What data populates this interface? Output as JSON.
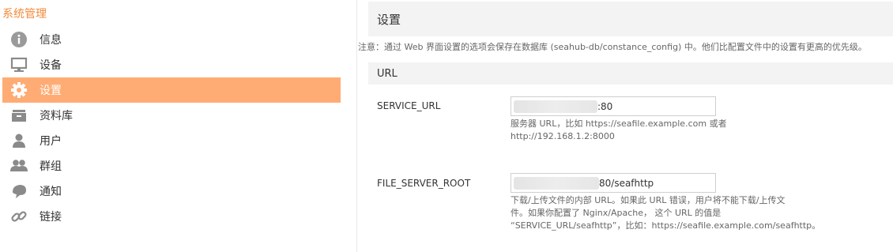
{
  "sidebar": {
    "title": "系统管理",
    "items": [
      {
        "label": "信息",
        "icon": "info-icon"
      },
      {
        "label": "设备",
        "icon": "monitor-icon"
      },
      {
        "label": "设置",
        "icon": "gear-icon"
      },
      {
        "label": "资料库",
        "icon": "library-icon"
      },
      {
        "label": "用户",
        "icon": "user-icon"
      },
      {
        "label": "群组",
        "icon": "group-icon"
      },
      {
        "label": "通知",
        "icon": "notification-icon"
      },
      {
        "label": "链接",
        "icon": "link-icon"
      }
    ],
    "active_index": 2,
    "accent_color": "#feac74",
    "title_color": "#f28a3a"
  },
  "main": {
    "page_title": "设置",
    "notice": "注意：通过 Web 界面设置的选项会保存在数据库 (seahub-db/constance_config) 中。他们比配置文件中的设置有更高的优先级。",
    "section_title": "URL",
    "fields": [
      {
        "label": "SERVICE_URL",
        "value": ":80",
        "help": [
          "服务器 URL，比如 https://seafile.example.com 或者",
          "http://192.168.1.2:8000"
        ]
      },
      {
        "label": "FILE_SERVER_ROOT",
        "value": "80/seafhttp",
        "help": [
          "下载/上传文件的内部 URL。如果此 URL 错误，用户将不能下载/上传文",
          "件。如果你配置了 Nginx/Apache， 这个 URL 的值是",
          "“SERVICE_URL/seafhttp”，比如：https://seafile.example.com/seafhttp。"
        ]
      }
    ]
  }
}
